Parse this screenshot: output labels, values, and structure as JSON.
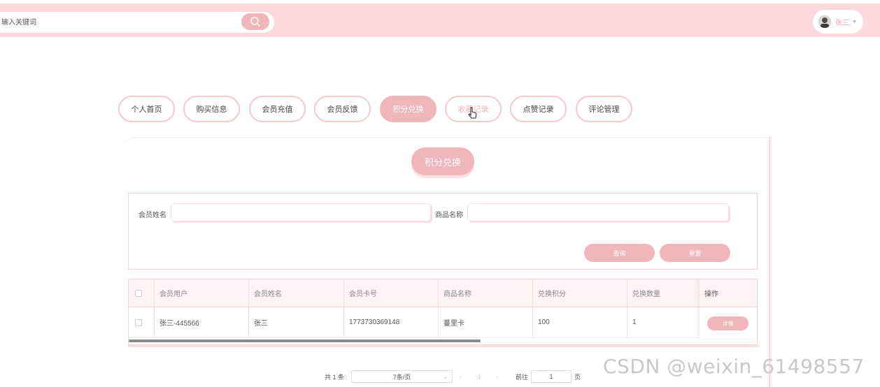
{
  "header": {
    "search_placeholder": "输入关键词",
    "user_name": "张三"
  },
  "tabs": [
    "个人首页",
    "购买信息",
    "会员充值",
    "会员反馈",
    "积分兑换",
    "收藏记录",
    "点赞记录",
    "评论管理"
  ],
  "active_tab": "积分兑换",
  "panel": {
    "title": "积分兑换"
  },
  "filter": {
    "member_name_label": "会员姓名",
    "product_name_label": "商品名称",
    "query_button": "查询",
    "reset_button": "重置"
  },
  "table": {
    "columns": [
      "会员用户",
      "会员姓名",
      "会员卡号",
      "商品名称",
      "兑换积分",
      "兑换数量",
      "操作"
    ],
    "rows": [
      {
        "member_user": "张三-445566",
        "member_name": "张三",
        "card_no": "1773730369148",
        "product": "蔓里卡",
        "points": "100",
        "quantity": "1",
        "action": "详情"
      }
    ]
  },
  "pager": {
    "total": "共 1 条",
    "page_size": "7条/页",
    "current_page": "1",
    "goto_label": "前往",
    "goto_value": "1",
    "page_suffix": "页"
  },
  "watermark": "CSDN @weixin_61498557",
  "colors": {
    "accent": "#f1b5bc",
    "topbar": "#fbd9dd",
    "border": "#f5c9ce"
  }
}
